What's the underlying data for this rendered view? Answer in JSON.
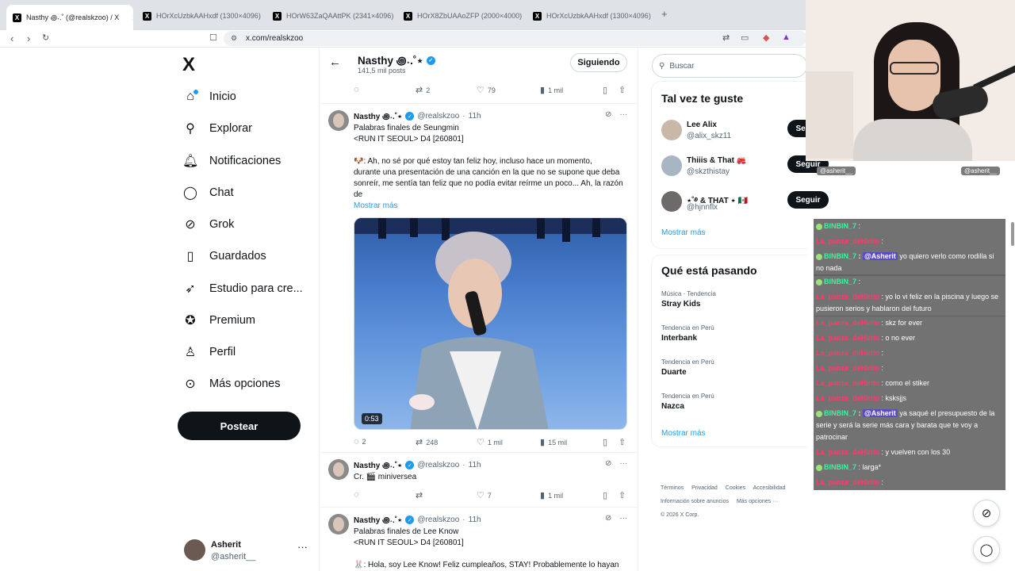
{
  "browser": {
    "tabs": [
      {
        "label": "Nasthy ꩜˖.˚ (@realskzoo) / X",
        "active": true
      },
      {
        "label": "HOrXcUzbkAAHxdf (1300×4096)",
        "active": false
      },
      {
        "label": "HOrW63ZaQAAttPK (2341×4096)",
        "active": false
      },
      {
        "label": "HOrX8ZbUAAoZFP (2000×4000)",
        "active": false
      },
      {
        "label": "HOrXcUzbkAAHxdf (1300×4096)",
        "active": false
      }
    ],
    "url": "x.com/realskzoo"
  },
  "nav": {
    "logo": "X",
    "items": [
      {
        "label": "Inicio",
        "icon": "home-icon"
      },
      {
        "label": "Explorar",
        "icon": "search-icon"
      },
      {
        "label": "Notificaciones",
        "icon": "bell-icon"
      },
      {
        "label": "Chat",
        "icon": "chat-icon"
      },
      {
        "label": "Grok",
        "icon": "grok-icon"
      },
      {
        "label": "Guardados",
        "icon": "bookmark-icon"
      },
      {
        "label": "Estudio para cre...",
        "icon": "rocket-icon"
      },
      {
        "label": "Premium",
        "icon": "premium-icon"
      },
      {
        "label": "Perfil",
        "icon": "person-icon"
      },
      {
        "label": "Más opciones",
        "icon": "more-circle-icon"
      }
    ],
    "post_label": "Postear",
    "account": {
      "name": "Asherit",
      "handle": "@asherit__"
    }
  },
  "profile_header": {
    "name": "Nasthy ꩜˖.˚⋆",
    "posts_count": "141,5 mil posts",
    "follow_label": "Siguiendo"
  },
  "top_actions": {
    "replies": "",
    "reposts": "2",
    "likes": "79",
    "views": "1 mil"
  },
  "tweets": [
    {
      "name": "Nasthy ꩜˖.˚⋆",
      "handle": "@realskzoo",
      "time": "11h",
      "lines": [
        "Palabras finales de Seungmin",
        "<RUN IT SEOUL> D4 [260801]",
        "",
        "🐶: Ah, no sé por qué estoy tan feliz hoy, incluso hace un momento,",
        "durante una presentación de una canción en la que no se supone que deba",
        "sonreír, me sentía tan feliz que no podía evitar reírme un poco... Ah, la razón",
        "de"
      ],
      "show_more": "Mostrar más",
      "media_duration": "0:53",
      "actions": {
        "replies": "2",
        "reposts": "248",
        "likes": "1 mil",
        "views": "15 mil"
      }
    },
    {
      "name": "Nasthy ꩜˖.˚⋆",
      "handle": "@realskzoo",
      "time": "11h",
      "lines": [
        "Cr. 🎬 miniversea"
      ],
      "actions": {
        "replies": "",
        "reposts": "",
        "likes": "7",
        "views": "1 mil"
      }
    },
    {
      "name": "Nasthy ꩜˖.˚⋆",
      "handle": "@realskzoo",
      "time": "11h",
      "lines": [
        "Palabras finales de Lee Know",
        "<RUN IT SEOUL> D4 [260801]",
        "",
        "🐰: Hola, soy Lee Know! Feliz cumpleaños, STAY! Probablemente lo hayan"
      ]
    }
  ],
  "sidebar": {
    "search_placeholder": "Buscar",
    "suggestions_title": "Tal vez te guste",
    "suggestions": [
      {
        "name": "Lee Alix",
        "handle": "@alix_skz11",
        "button": "Seguir"
      },
      {
        "name": "Thiiis & That 🚒",
        "handle": "@skzthistay",
        "button": "Seguir"
      },
      {
        "name": "⋆˚࿔ & THAT ⋆ 🇲🇽",
        "handle": "@hjnnflx",
        "button": "Seguir"
      }
    ],
    "show_more": "Mostrar más",
    "trends_title": "Qué está pasando",
    "trends": [
      {
        "context": "Música · Tendencia",
        "name": "Stray Kids"
      },
      {
        "context": "Tendencia en Perú",
        "name": "Interbank"
      },
      {
        "context": "Tendencia en Perú",
        "name": "Duarte"
      },
      {
        "context": "Tendencia en Perú",
        "name": "Nazca"
      }
    ],
    "trends_more": "Mostrar más",
    "footer": [
      "Términos",
      "Privacidad",
      "Cookies",
      "Accesibilidad",
      "Información sobre anuncios",
      "Más opciones ···",
      "© 2026 X Corp."
    ]
  },
  "stream": {
    "tag_left": "@asherit__",
    "tag_right": "@asherit__",
    "chat": [
      {
        "user": "BINBIN_7",
        "green": true,
        "mention": "",
        "text": ":"
      },
      {
        "user": "La_panza_deHirito",
        "green": false,
        "mention": "",
        "text": ":"
      },
      {
        "user": "BINBIN_7",
        "green": true,
        "mention": "@Asherit",
        "text": "yo quiero verlo como rodilla si no nada"
      },
      {
        "user": "BINBIN_7",
        "green": true,
        "mention": "",
        "text": ":"
      },
      {
        "user": "La_panza_deHirito",
        "green": false,
        "mention": "",
        "text": ": yo lo vi feliz en la piscina y luego se pusieron serios y hablaron del futuro"
      },
      {
        "user": "La_panza_deHirito",
        "green": false,
        "mention": "",
        "text": ": skz for ever"
      },
      {
        "user": "La_panza_deHirito",
        "green": false,
        "mention": "",
        "text": ": o no ever"
      },
      {
        "user": "La_panza_deHirito",
        "green": false,
        "mention": "",
        "text": ":"
      },
      {
        "user": "La_panza_deHirito",
        "green": false,
        "mention": "",
        "text": ":"
      },
      {
        "user": "La_panza_deHirito",
        "green": false,
        "mention": "",
        "text": ": como el stiker"
      },
      {
        "user": "La_panza_deHirito",
        "green": false,
        "mention": "",
        "text": ": ksksjjs"
      },
      {
        "user": "BINBIN_7",
        "green": true,
        "mention": "@Asherit",
        "text": "ya saqué el presupuesto de la serie y será la serie más cara y barata que te voy a patrocinar"
      },
      {
        "user": "La_panza_deHirito",
        "green": false,
        "mention": "",
        "text": ": y vuelven con los 30"
      },
      {
        "user": "BINBIN_7",
        "green": true,
        "mention": "",
        "text": ": larga*"
      },
      {
        "user": "La_panza_deHirito",
        "green": false,
        "mention": "",
        "text": ":"
      }
    ]
  }
}
